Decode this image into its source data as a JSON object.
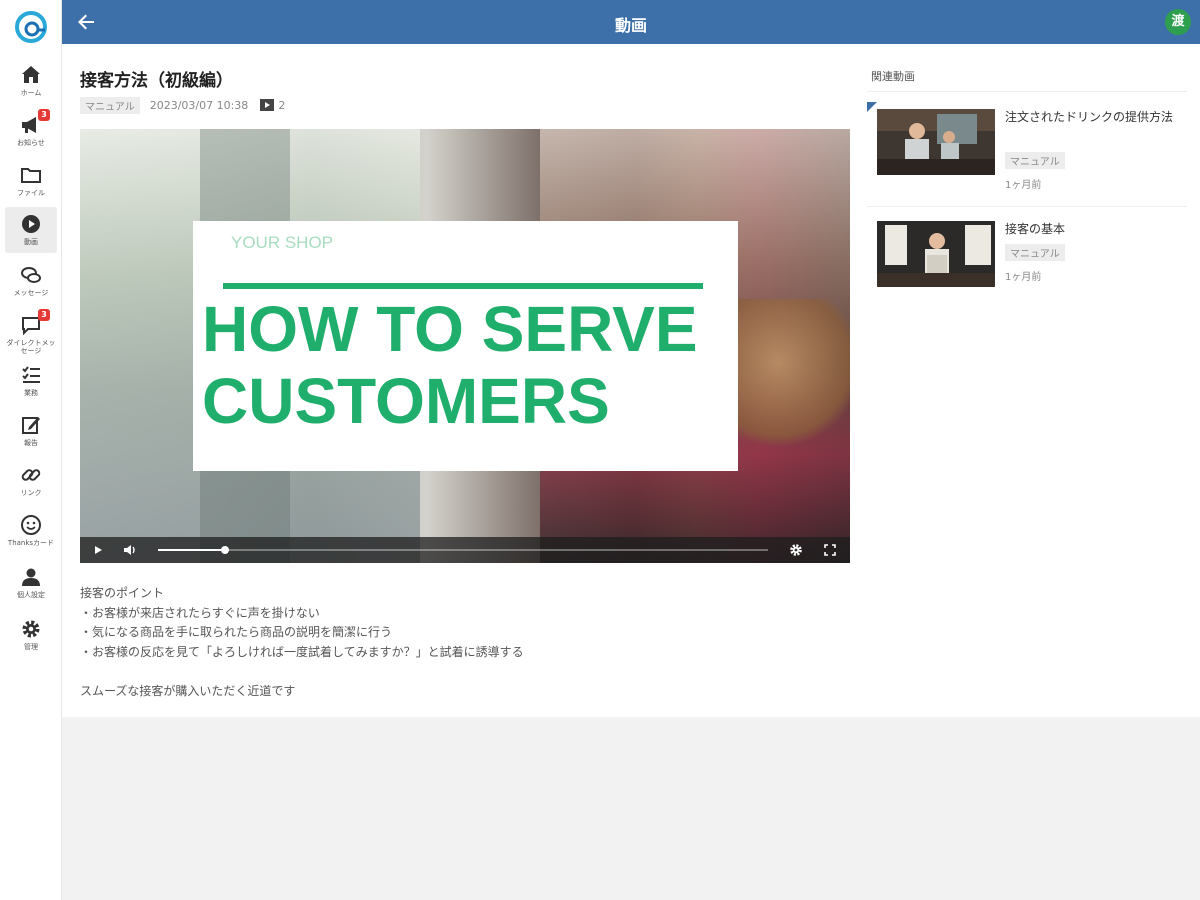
{
  "header": {
    "title": "動画",
    "avatar_text": "渡"
  },
  "sidebar": {
    "items": [
      {
        "label": "ホーム",
        "icon": "home-icon"
      },
      {
        "label": "お知らせ",
        "icon": "megaphone-icon",
        "badge": "3"
      },
      {
        "label": "ファイル",
        "icon": "folder-icon"
      },
      {
        "label": "動画",
        "icon": "play-circle-icon",
        "active": true
      },
      {
        "label": "メッセージ",
        "icon": "chat-bubbles-icon"
      },
      {
        "label": "ダイレクトメッセージ",
        "icon": "direct-message-icon",
        "badge": "3"
      },
      {
        "label": "業務",
        "icon": "checklist-icon"
      },
      {
        "label": "報告",
        "icon": "edit-note-icon"
      },
      {
        "label": "リンク",
        "icon": "link-icon"
      },
      {
        "label": "Thanksカード",
        "icon": "smile-icon"
      },
      {
        "label": "個人設定",
        "icon": "person-icon"
      },
      {
        "label": "管理",
        "icon": "gear-icon"
      }
    ]
  },
  "video": {
    "title": "接客方法（初級編）",
    "tag": "マニュアル",
    "datetime": "2023/03/07 10:38",
    "views": "2",
    "slide_shop": "YOUR SHOP",
    "slide_headline": "HOW TO SERVE CUSTOMERS",
    "progress": 0.11
  },
  "description": {
    "heading": "接客のポイント",
    "points": [
      "・お客様が来店されたらすぐに声を掛けない",
      "・気になる商品を手に取られたら商品の説明を簡潔に行う",
      "・お客様の反応を見て「よろしければ一度試着してみますか？」と試着に誘導する"
    ],
    "closing": "スムーズな接客が購入いただく近道です"
  },
  "related": {
    "heading": "関連動画",
    "items": [
      {
        "title": "注文されたドリンクの提供方法",
        "tag": "マニュアル",
        "age": "1ヶ月前"
      },
      {
        "title": "接客の基本",
        "tag": "マニュアル",
        "age": "1ヶ月前"
      }
    ]
  }
}
